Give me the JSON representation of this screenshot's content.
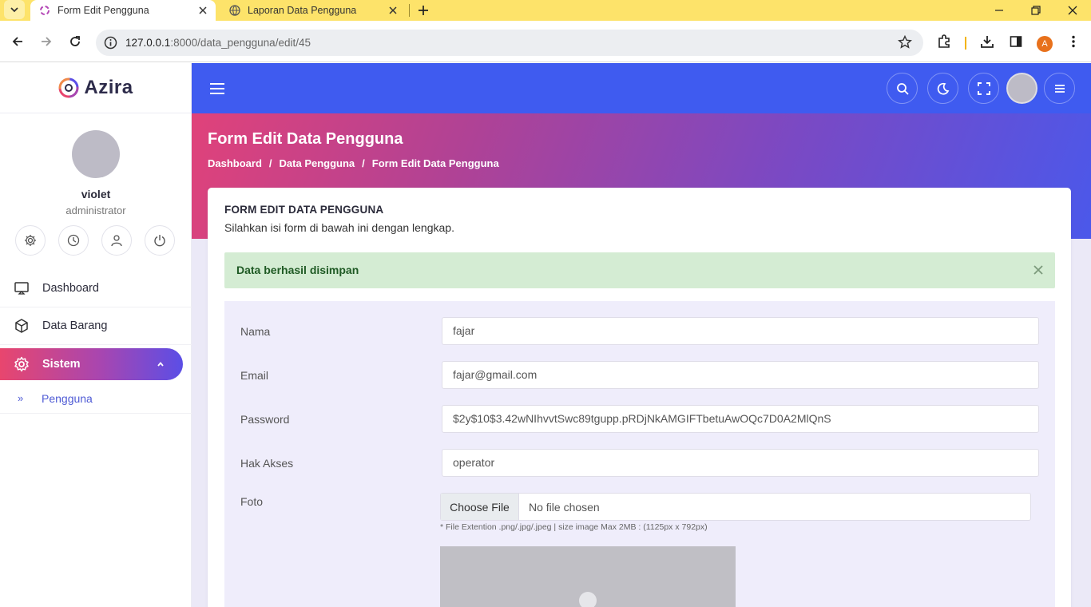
{
  "browser": {
    "tabs": [
      {
        "title": "Form Edit Pengguna",
        "active": true
      },
      {
        "title": "Laporan Data Pengguna",
        "active": false
      }
    ],
    "url_host": "127.0.0.1",
    "url_path": ":8000/data_pengguna/edit/45",
    "profile_initial": "A",
    "accent_color": "#fde36a"
  },
  "sidebar": {
    "brand": "Azira",
    "user": {
      "name": "violet",
      "role": "administrator"
    },
    "user_actions": [
      "gear-icon",
      "clock-icon",
      "user-icon",
      "power-icon"
    ],
    "menu": [
      {
        "label": "Dashboard",
        "icon": "monitor-icon"
      },
      {
        "label": "Data Barang",
        "icon": "box-icon"
      },
      {
        "label": "Sistem",
        "icon": "gear-icon",
        "active": true
      }
    ],
    "submenu": [
      {
        "label": "Pengguna",
        "icon": "double-chevron-icon"
      }
    ]
  },
  "header": {
    "title": "Form Edit Data Pengguna",
    "breadcrumb": [
      "Dashboard",
      "Data Pengguna",
      "Form Edit Data Pengguna"
    ],
    "breadcrumb_sep": "/"
  },
  "card": {
    "title": "FORM EDIT DATA PENGGUNA",
    "subtitle": "Silahkan isi form di bawah ini dengan lengkap.",
    "alert": "Data berhasil disimpan"
  },
  "form": {
    "nama": {
      "label": "Nama",
      "value": "fajar"
    },
    "email": {
      "label": "Email",
      "value": "fajar@gmail.com"
    },
    "password": {
      "label": "Password",
      "value": "$2y$10$3.42wNIhvvtSwc89tgupp.pRDjNkAMGIFTbetuAwOQc7D0A2MlQnS"
    },
    "hak_akses": {
      "label": "Hak Akses",
      "value": "operator"
    },
    "foto": {
      "label": "Foto",
      "button": "Choose File",
      "status": "No file chosen",
      "hint": "* File Extention .png/.jpg/.jpeg | size image Max 2MB : (1125px x 792px)"
    }
  },
  "colors": {
    "topnav": "#3f5bf0",
    "gradient_start": "#e8466e",
    "gradient_end": "#5b4ee6",
    "success_bg": "#d4ecd3",
    "link": "#4f5bd5"
  }
}
